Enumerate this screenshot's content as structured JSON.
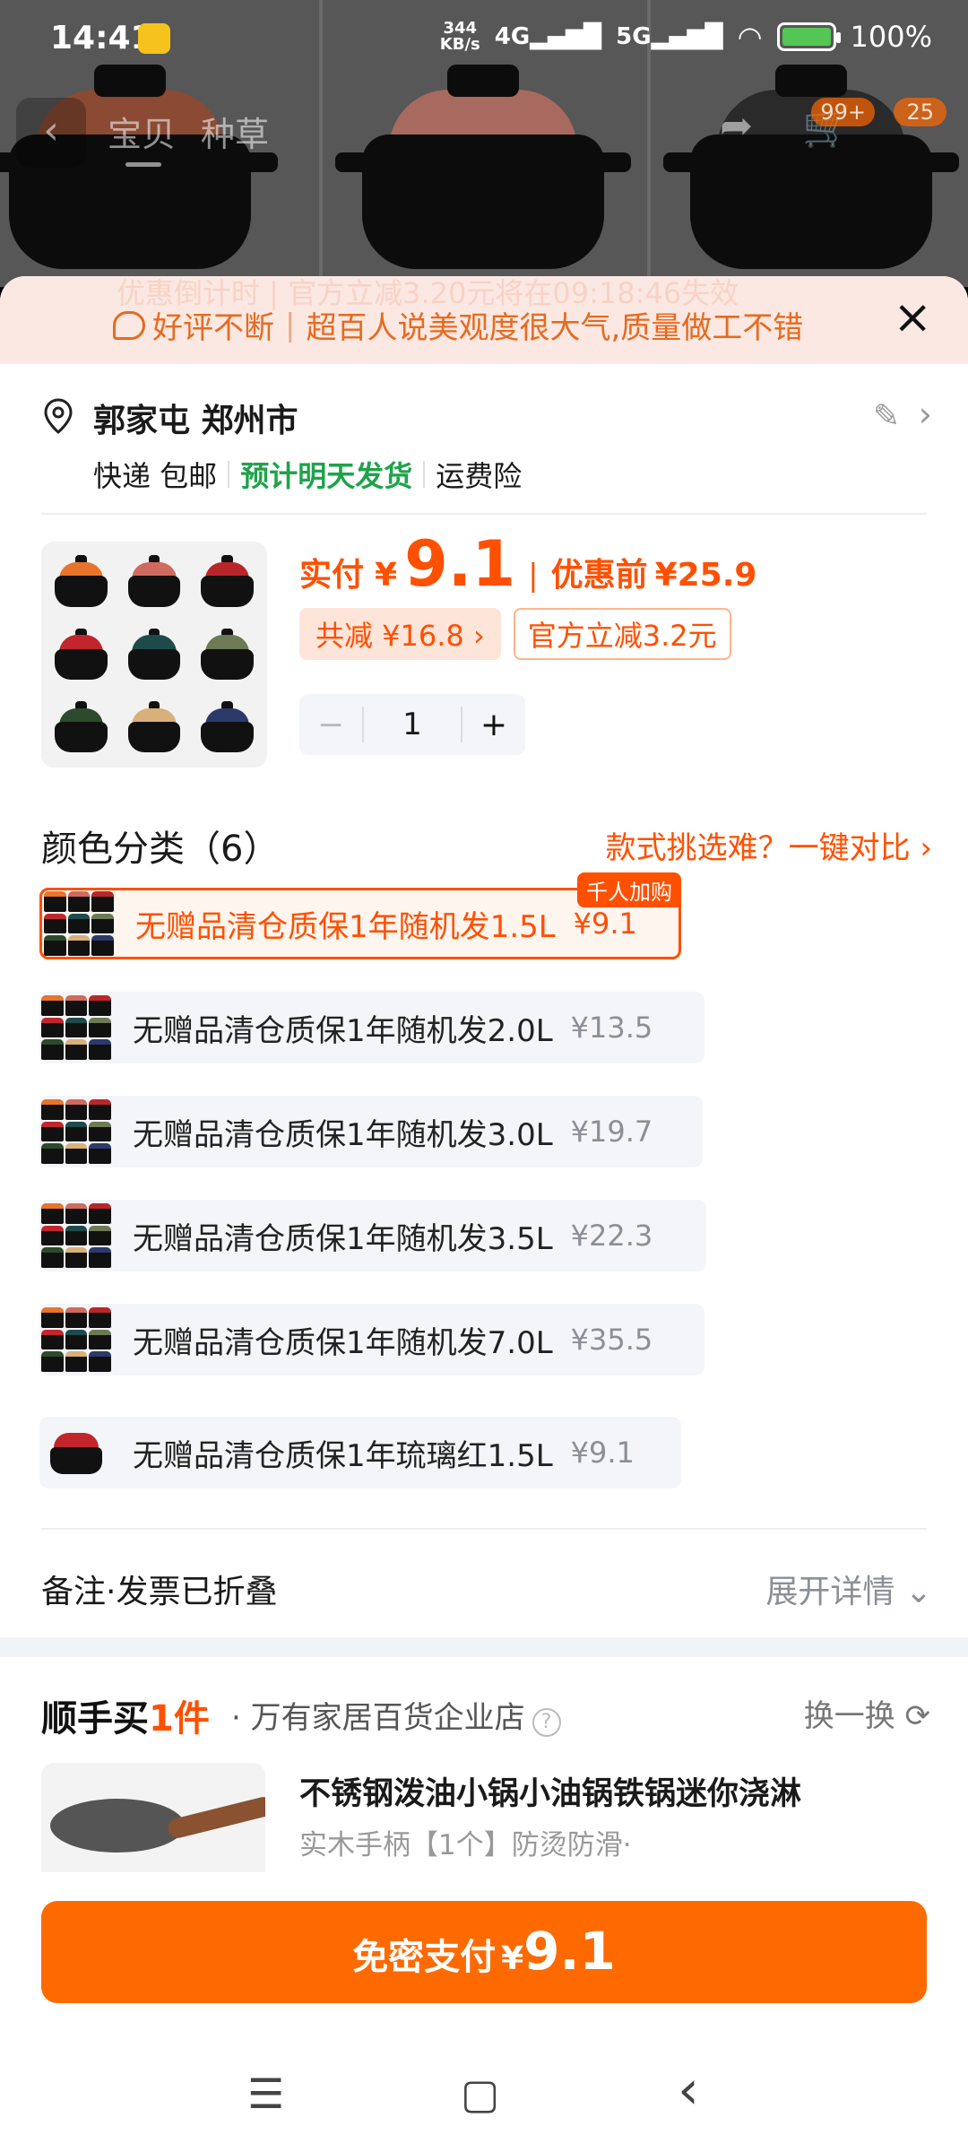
{
  "status_bar": {
    "time": "14:41",
    "speed_value": "344",
    "speed_unit": "KB/s",
    "net1": "4G",
    "net2": "5G",
    "battery": "100%"
  },
  "background_nav": {
    "back_icon": "chevron-left-icon",
    "tabs": [
      "宝贝",
      "种草"
    ],
    "cart_badge": "99+",
    "more_badge": "25"
  },
  "banner": {
    "ghost_text": "优惠倒计时 | 官方立减3.20元将在09:18:46失效",
    "message_part1": "好评不断",
    "message_part2": "超百人说美观度很大气,质量做工不错",
    "close_icon": "×"
  },
  "address": {
    "name": "郭家屯 郑州市",
    "delivery": "快递 包邮",
    "eta": "预计明天发货",
    "insurance": "运费险"
  },
  "product": {
    "paid_label": "实付",
    "currency": "¥",
    "paid_price": "9.1",
    "before_label": "优惠前",
    "before_price": "¥25.9",
    "discount_total": "共减 ¥16.8 ›",
    "discount_official": "官方立减3.2元",
    "quantity": "1",
    "minus": "−",
    "plus": "+"
  },
  "colors": {
    "title": "颜色分类（6）",
    "compare_link": "款式挑选难？一键对比 ›",
    "hot_tag": "千人加购",
    "options": [
      {
        "name": "无赠品清仓质保1年随机发1.5L",
        "price": "¥9.1",
        "selected": true
      },
      {
        "name": "无赠品清仓质保1年随机发2.0L",
        "price": "¥13.5",
        "selected": false
      },
      {
        "name": "无赠品清仓质保1年随机发3.0L",
        "price": "¥19.7",
        "selected": false
      },
      {
        "name": "无赠品清仓质保1年随机发3.5L",
        "price": "¥22.3",
        "selected": false
      },
      {
        "name": "无赠品清仓质保1年随机发7.0L",
        "price": "¥35.5",
        "selected": false
      },
      {
        "name": "无赠品清仓质保1年琉璃红1.5L",
        "price": "¥9.1",
        "selected": false
      }
    ]
  },
  "remark": {
    "label": "备注·发票已折叠",
    "expand": "展开详情 ⌄"
  },
  "addon": {
    "brand_part1": "顺手买",
    "brand_part2": "1件",
    "store": "· 万有家居百货企业店",
    "help": "?",
    "swap": "换一换 ⟳",
    "item_name": "不锈钢泼油小锅小油锅铁锅迷你浇淋",
    "item_desc": "实木手柄【1个】防烫防滑·"
  },
  "pay": {
    "label": "免密支付",
    "currency": "¥",
    "amount": "9.1"
  },
  "nav": {
    "menu": "☰",
    "home": "▢",
    "back": "‹"
  },
  "colors_palette": {
    "accent": "#ff5000",
    "green": "#1ea34a",
    "banner_bg": "#fbe8e2"
  }
}
